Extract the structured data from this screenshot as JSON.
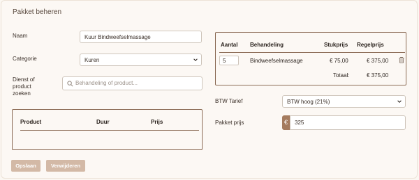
{
  "page": {
    "title": "Pakket beheren"
  },
  "form": {
    "naam_label": "Naam",
    "naam_value": "Kuur Bindweefselmassage",
    "categorie_label": "Categorie",
    "categorie_value": "Kuren",
    "dienst_label_line1": "Dienst of",
    "dienst_label_line2": "product",
    "dienst_label_line3": "zoeken",
    "search_placeholder": "Behandeling of product..."
  },
  "product_table": {
    "headers": [
      "Product",
      "Duur",
      "Prijs"
    ]
  },
  "package_table": {
    "headers": [
      "Aantal",
      "Behandeling",
      "Stukprijs",
      "Regelprijs"
    ],
    "rows": [
      {
        "aantal": "5",
        "behandeling": "Bindweefselmassage",
        "stukprijs": "€ 75,00",
        "regelprijs": "€ 375,00"
      }
    ],
    "total_label": "Totaal:",
    "total_value": "€ 375,00"
  },
  "btw": {
    "label": "BTW Tarief",
    "value": "BTW hoog (21%)"
  },
  "pakket_prijs": {
    "label": "Pakket prijs",
    "currency": "€",
    "value": "325"
  },
  "buttons": {
    "save": "Opslaan",
    "delete": "Verwijderen"
  }
}
